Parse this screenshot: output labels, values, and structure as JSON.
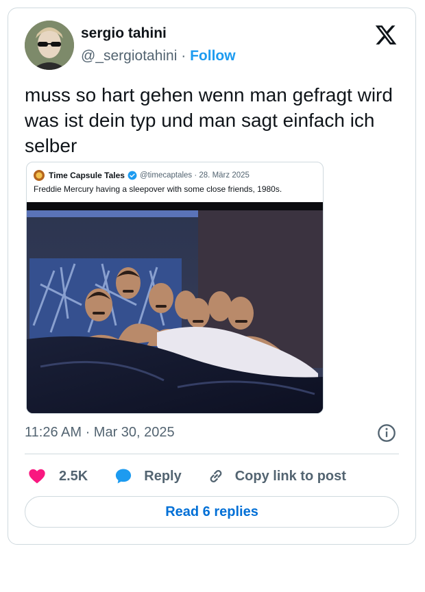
{
  "tweet": {
    "author_name": "sergio tahini",
    "author_handle": "@_sergiotahini",
    "separator": " · ",
    "follow_label": "Follow",
    "text": "muss so hart gehen wenn man gefragt wird was ist dein typ und man sagt einfach ich selber",
    "timestamp": "11:26 AM · Mar 30, 2025"
  },
  "quoted": {
    "name": "Time Capsule Tales",
    "meta": "@timecaptales · 28. März 2025",
    "text": "Freddie Mercury having a sleepover with some close friends, 1980s.",
    "verified": true
  },
  "actions": {
    "like_count": "2.5K",
    "reply_label": "Reply",
    "copy_link_label": "Copy link to post"
  },
  "footer": {
    "read_replies_label": "Read 6 replies"
  },
  "colors": {
    "accent": "#1d9bf0",
    "like": "#f91880",
    "reply_link": "#006fd6",
    "muted": "#536471",
    "border": "#cfd9de"
  },
  "icons": {
    "logo": "x-logo-icon",
    "verified": "verified-badge-icon",
    "like": "heart-icon",
    "reply": "speech-bubble-icon",
    "copy": "link-icon",
    "info": "info-icon"
  }
}
